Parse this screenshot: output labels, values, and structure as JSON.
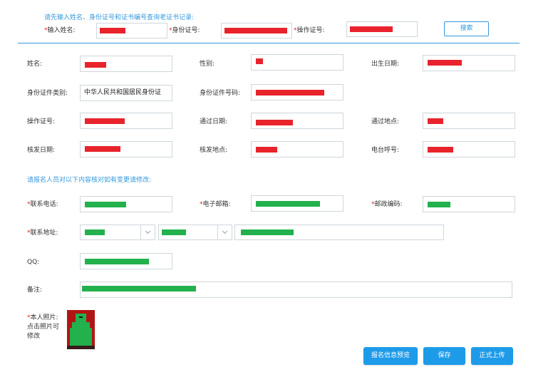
{
  "search": {
    "hint": "请先输入姓名、身份证号和证书编号查询老证书记录:",
    "name_label": "输入姓名:",
    "id_label": "身份证号:",
    "cert_label": "操作证号:",
    "search_button": "搜索"
  },
  "info": {
    "name_label": "姓名:",
    "gender_label": "性别:",
    "birth_label": "出生日期:",
    "id_type_label": "身份证件类别:",
    "id_type_value": "中华人民共和国居民身份证",
    "id_number_label": "身份证件号码:",
    "cert_no_label": "操作证号:",
    "pass_date_label": "通过日期:",
    "pass_place_label": "通过地点:",
    "issue_date_label": "核发日期:",
    "issue_place_label": "核发地点:",
    "callsign_label": "电台呼号:"
  },
  "edit": {
    "hint": "请报名人员对以下内容核对如有变更请修改:",
    "phone_label": "联系电话:",
    "email_label": "电子邮箱:",
    "zip_label": "邮政编码:",
    "address_label": "联系地址:",
    "qq_label": "QQ:",
    "remark_label": "备注:",
    "photo_label_1": "本人照片:",
    "photo_label_2": "点击照片可",
    "photo_label_3": "修改"
  },
  "required_mark": "*",
  "buttons": {
    "preview": "报名信息预览",
    "save": "保存",
    "submit": "正式上传"
  },
  "colors": {
    "accent": "#1e9be8",
    "redaction_red": "#e8232c",
    "redaction_green": "#22b14c"
  }
}
